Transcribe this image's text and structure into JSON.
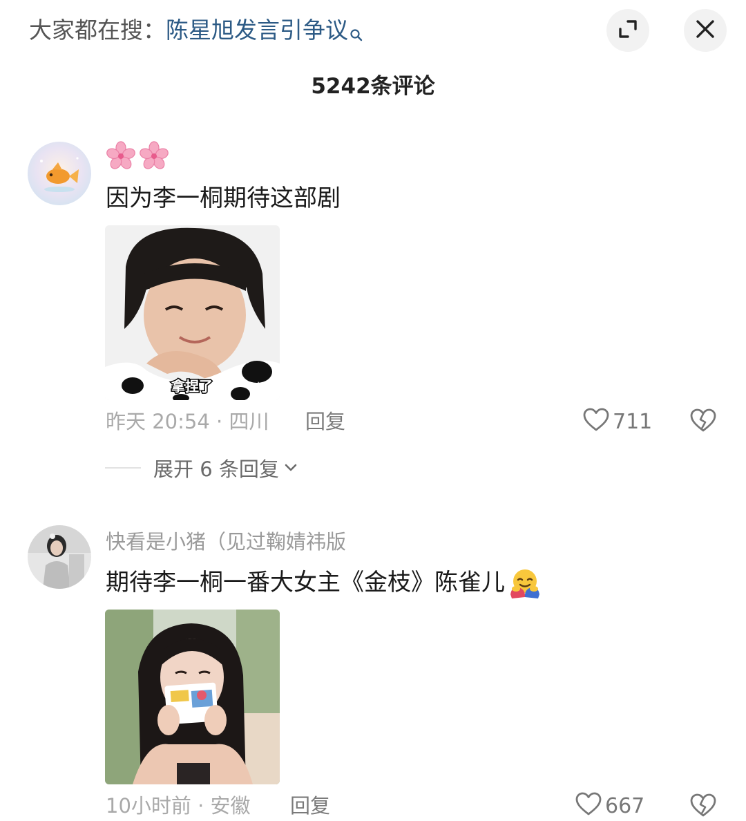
{
  "header": {
    "search_prefix": "大家都在搜：",
    "search_term": "陈星旭发言引争议",
    "minimize_icon": "minimize-icon",
    "close_icon": "close-icon"
  },
  "comments_header": {
    "count_label": "5242条评论"
  },
  "comments": [
    {
      "username": "",
      "username_emoji": [
        "cherry-blossom",
        "cherry-blossom"
      ],
      "text": "因为李一桐期待这部剧",
      "image_caption": "拿捏了",
      "time_location": "昨天 20:54 · 四川",
      "reply_label": "回复",
      "likes": "711",
      "expand_label": "展开 6 条回复"
    },
    {
      "username": "快看是小猪（见过鞠婧祎版",
      "text": "期待李一桐一番大女主《金枝》陈雀儿",
      "text_emoji": "hugging-face",
      "time_location": "10小时前 · 安徽",
      "reply_label": "回复",
      "likes": "667"
    }
  ],
  "colors": {
    "search_term": "#2c5a85",
    "meta_gray": "#a9a9a9",
    "button_bg": "#f2f2f2"
  }
}
